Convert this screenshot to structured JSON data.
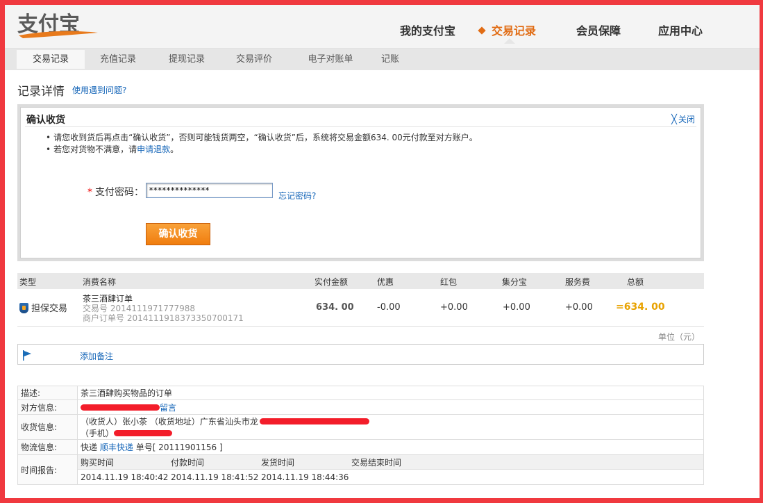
{
  "brand": {
    "logo_text": "支付宝"
  },
  "top_nav": [
    {
      "label": "我的支付宝",
      "active": false
    },
    {
      "label": "交易记录",
      "active": true
    },
    {
      "label": "会员保障",
      "active": false
    },
    {
      "label": "应用中心",
      "active": false
    }
  ],
  "sub_nav": [
    {
      "label": "交易记录",
      "active": true
    },
    {
      "label": "充值记录",
      "active": false
    },
    {
      "label": "提现记录",
      "active": false
    },
    {
      "label": "交易评价",
      "active": false
    },
    {
      "label": "电子对账单",
      "active": false
    },
    {
      "label": "记账",
      "active": false
    }
  ],
  "page": {
    "title": "记录详情",
    "help_link": "使用遇到问题?"
  },
  "confirm": {
    "title": "确认收货",
    "close_label": "关闭",
    "notes": [
      {
        "text": "请您收到货后再点击“确认收货”，否则可能钱货两空，“确认收货”后，系统将交易金额634. 00元付款至对方账户。"
      },
      {
        "prefix": "若您对货物不满意，请",
        "link": "申请退款",
        "suffix": "。"
      }
    ],
    "password_label": "支付密码：",
    "password_required_mark": "*",
    "password_value": "**************",
    "forgot_link": "忘记密码?",
    "button_label": "确认收货"
  },
  "order": {
    "headers": [
      "类型",
      "消费名称",
      "实付金额",
      "优惠",
      "红包",
      "集分宝",
      "服务费",
      "总额"
    ],
    "row": {
      "type": "担保交易",
      "name": "茶三酒肆订单",
      "trade_no_label": "交易号",
      "trade_no": "2014111971777988",
      "merchant_no_label": "商户订单号",
      "merchant_no": "2014111918373350700171",
      "paid": "634. 00",
      "discount": "-0.00",
      "red_packet": "+0.00",
      "points": "+0.00",
      "service_fee": "+0.00",
      "total": "=634. 00"
    },
    "unit": "单位（元）"
  },
  "remark": {
    "add_label": "添加备注"
  },
  "details": {
    "desc_label": "描述:",
    "desc_value": "茶三酒肆购买物品的订单",
    "counterparty_label": "对方信息:",
    "counterparty_link": "留言",
    "receiver_label": "收货信息:",
    "receiver_line1": "（收货人）张小茶 （收货地址）广东省汕头市龙",
    "receiver_line2": "（手机）",
    "logistics_label": "物流信息:",
    "logistics_prefix": "快递",
    "logistics_company": "顺丰快递",
    "logistics_no": "单号[ 20111901156 ]",
    "time_label": "时间报告:",
    "time_headers": [
      "购买时间",
      "付款时间",
      "发货时间",
      "交易结束时间"
    ],
    "time_values": [
      "2014.11.19 18:40:42",
      "2014.11.19 18:41:52",
      "2014.11.19 18:44:36",
      ""
    ]
  },
  "colors": {
    "accent": "#e16c14",
    "link": "#1465b8",
    "frame": "#f0393f",
    "total": "#e8a200"
  }
}
